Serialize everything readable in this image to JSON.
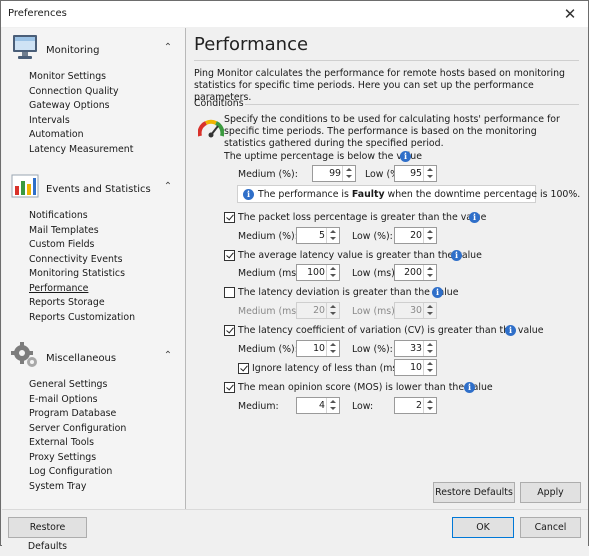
{
  "window": {
    "title": "Preferences",
    "close_glyph": "✕"
  },
  "sidebar": {
    "groups": [
      {
        "label": "Monitoring",
        "icon": "monitor-icon",
        "items": [
          "Monitor Settings",
          "Connection Quality",
          "Gateway Options",
          "Intervals",
          "Automation",
          "Latency Measurement"
        ]
      },
      {
        "label": "Events and Statistics",
        "icon": "chart-icon",
        "items": [
          "Notifications",
          "Mail Templates",
          "Custom Fields",
          "Connectivity Events",
          "Monitoring Statistics",
          "Performance",
          "Reports Storage",
          "Reports Customization"
        ]
      },
      {
        "label": "Miscellaneous",
        "icon": "gears-icon",
        "items": [
          "General Settings",
          "E-mail Options",
          "Program Database",
          "Server Configuration",
          "External Tools",
          "Proxy Settings",
          "Log Configuration",
          "System Tray"
        ]
      }
    ],
    "active_item": "Performance",
    "chevron": "⌃"
  },
  "page": {
    "title": "Performance",
    "description": "Ping Monitor calculates the performance for remote hosts based on monitoring statistics for specific time periods. Here you can set up the performance parameters.",
    "conditions_label": "Conditions",
    "spec_text": "Specify the conditions to be used for calculating hosts' performance for specific time periods. The performance is based on the monitoring statistics gathered during the specified period.",
    "uptime": {
      "label": "The uptime percentage is below the value",
      "medium_label": "Medium (%):",
      "medium": "99",
      "low_label": "Low (%):",
      "low": "95"
    },
    "note": {
      "pre": "The performance is ",
      "bold": "Faulty",
      "post": " when the downtime percentage is 100%."
    },
    "packet_loss": {
      "label": "The packet loss percentage is greater than the value",
      "checked": true,
      "medium_label": "Medium (%):",
      "medium": "5",
      "low_label": "Low (%):",
      "low": "20"
    },
    "latency": {
      "label": "The average latency value is greater than the value",
      "checked": true,
      "medium_label": "Medium (ms):",
      "medium": "100",
      "low_label": "Low (ms):",
      "low": "200"
    },
    "deviation": {
      "label": "The latency deviation is greater than the value",
      "checked": false,
      "medium_label": "Medium (ms):",
      "medium": "20",
      "low_label": "Low (ms):",
      "low": "30"
    },
    "cv": {
      "label": "The latency coefficient of variation (CV) is greater than the value",
      "checked": true,
      "medium_label": "Medium (%):",
      "medium": "10",
      "low_label": "Low (%):",
      "low": "33",
      "ignore_label": "Ignore latency of less than (ms):",
      "ignore_checked": true,
      "ignore": "10"
    },
    "mos": {
      "label": "The mean opinion score (MOS) is lower than the value",
      "checked": true,
      "medium_label": "Medium:",
      "medium": "4",
      "low_label": "Low:",
      "low": "2"
    },
    "restore_defaults": "Restore Defaults",
    "apply": "Apply"
  },
  "footer": {
    "restore_defaults": "Restore Defaults",
    "ok": "OK",
    "cancel": "Cancel"
  },
  "colors": {
    "info_blue": "#2f6fc9",
    "primary_border": "#0078d7"
  }
}
